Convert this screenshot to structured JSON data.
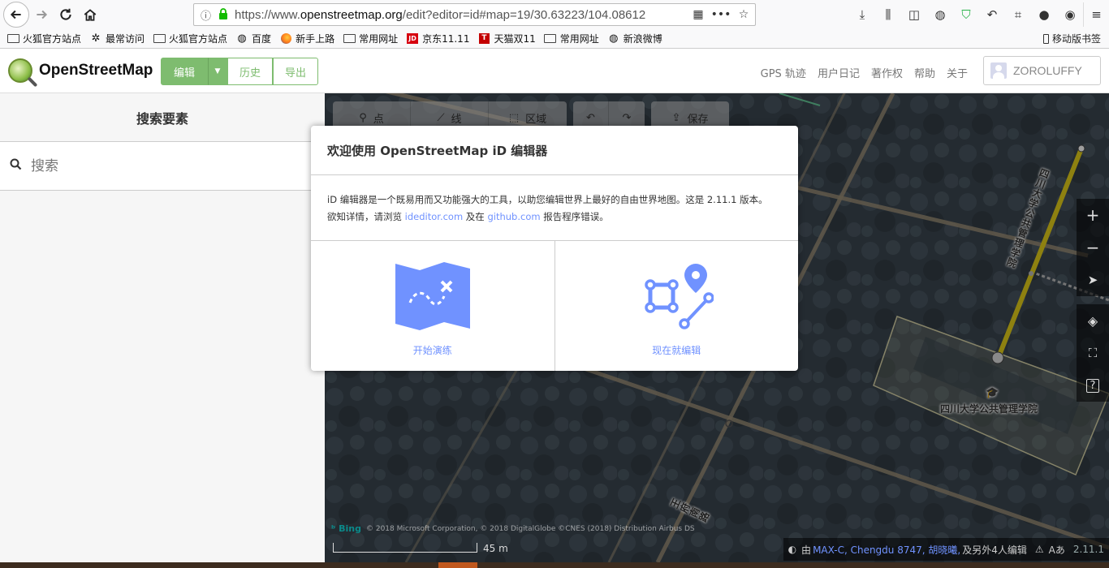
{
  "browser": {
    "url_prefix": "https://www.",
    "url_domain": "openstreetmap.org",
    "url_rest": "/edit?editor=id#map=19/30.63223/104.08612",
    "bookmarks": [
      {
        "label": "火狐官方站点",
        "icon": "folder-icon"
      },
      {
        "label": "最常访问",
        "icon": "gear-icon"
      },
      {
        "label": "火狐官方站点",
        "icon": "folder-icon"
      },
      {
        "label": "百度",
        "icon": "globe-icon"
      },
      {
        "label": "新手上路",
        "icon": "firefox-icon"
      },
      {
        "label": "常用网址",
        "icon": "folder-icon"
      },
      {
        "label": "京东11.11",
        "icon": "jd-icon"
      },
      {
        "label": "天猫双11",
        "icon": "tmall-icon"
      },
      {
        "label": "常用网址",
        "icon": "folder-icon"
      },
      {
        "label": "新浪微博",
        "icon": "globe-icon"
      }
    ],
    "mobile_bookmarks": "移动版书签"
  },
  "header": {
    "logo_text": "OpenStreetMap",
    "edit_label": "编辑",
    "history_label": "历史",
    "export_label": "导出",
    "links": [
      "GPS 轨迹",
      "用户日记",
      "著作权",
      "帮助",
      "关于"
    ],
    "username": "ZOROLUFFY"
  },
  "sidebar": {
    "title": "搜索要素",
    "search_placeholder": "搜索"
  },
  "toolbar": {
    "point": "点",
    "line": "线",
    "area": "区域",
    "save": "保存"
  },
  "map_labels": {
    "building": "四川大学公共管理学院",
    "road_vertical": "四川大学公共管理学院",
    "road_south": "王府南路"
  },
  "modal": {
    "title": "欢迎使用 OpenStreetMap iD 编辑器",
    "line1": "iD 编辑器是一个既易用而又功能强大的工具，以助您编辑世界上最好的自由世界地图。这是 2.11.1 版本。",
    "line2_a": "欲知详情，请浏览 ",
    "link1": "ideditor.com",
    "line2_b": " 及在 ",
    "link2": "github.com",
    "line2_c": " 报告程序错误。",
    "walkthrough": "开始演练",
    "start_editing": "现在就编辑"
  },
  "footer": {
    "attribution": "© 2018 Microsoft Corporation, © 2018 DigitalGlobe ©CNES (2018) Distribution Airbus DS",
    "bing": "Bing",
    "scale": "45 m",
    "edited_by": "由",
    "contributors": "MAX-C, Chengdu 8747, 胡晓曦,",
    "others": "及另外4人编辑",
    "version": "2.11.1"
  },
  "colors": {
    "osm_green": "#7ebc6f",
    "id_blue": "#7092ff",
    "path_yellow": "#e6d11a"
  }
}
